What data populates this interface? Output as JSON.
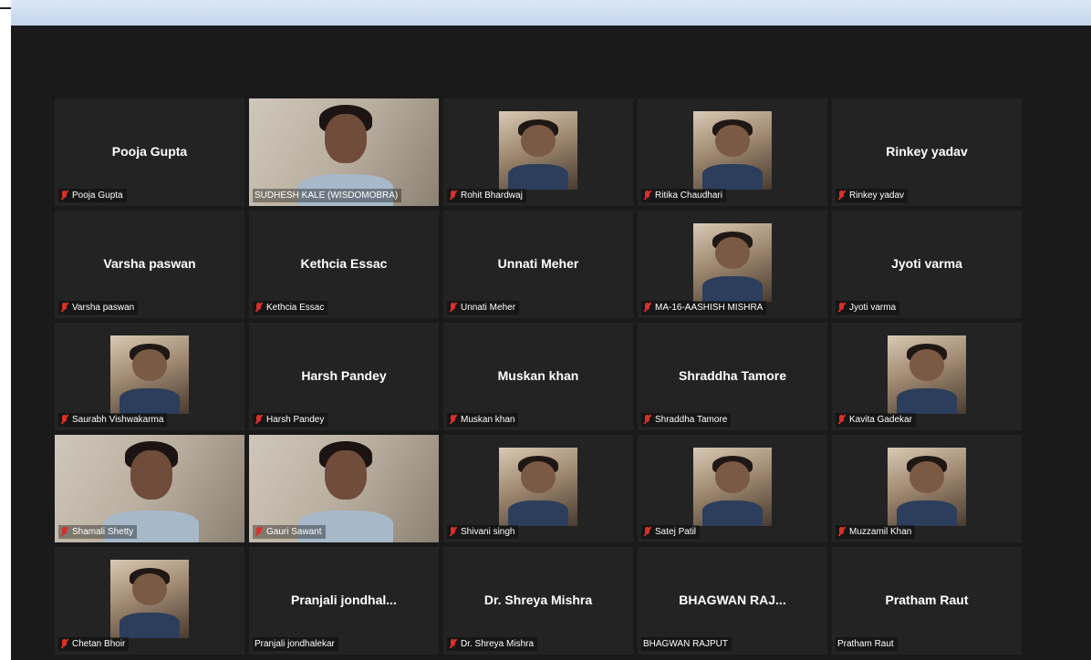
{
  "window": {
    "title": ""
  },
  "participants": [
    {
      "tile_name": "Pooja Gupta",
      "label": "Pooja Gupta",
      "video": "none",
      "muted": true
    },
    {
      "tile_name": "",
      "label": "SUDHESH KALE (WISDOMOBRA)",
      "video": "camera",
      "muted": false,
      "active_speaker": true
    },
    {
      "tile_name": "",
      "label": "Rohit Bhardwaj",
      "video": "photo",
      "muted": true
    },
    {
      "tile_name": "",
      "label": "Ritika Chaudhari",
      "video": "photo",
      "muted": true
    },
    {
      "tile_name": "Rinkey yadav",
      "label": "Rinkey yadav",
      "video": "none",
      "muted": true
    },
    {
      "tile_name": "Varsha paswan",
      "label": "Varsha paswan",
      "video": "none",
      "muted": true
    },
    {
      "tile_name": "Kethcia Essac",
      "label": "Kethcia Essac",
      "video": "none",
      "muted": true
    },
    {
      "tile_name": "Unnati Meher",
      "label": "Unnati Meher",
      "video": "none",
      "muted": true
    },
    {
      "tile_name": "",
      "label": "MA-16-AASHISH MISHRA",
      "video": "photo",
      "muted": true
    },
    {
      "tile_name": "Jyoti varma",
      "label": "Jyoti varma",
      "video": "none",
      "muted": true
    },
    {
      "tile_name": "",
      "label": "Saurabh Vishwakarma",
      "video": "photo",
      "muted": true
    },
    {
      "tile_name": "Harsh Pandey",
      "label": "Harsh Pandey",
      "video": "none",
      "muted": true
    },
    {
      "tile_name": "Muskan khan",
      "label": "Muskan khan",
      "video": "none",
      "muted": true
    },
    {
      "tile_name": "Shraddha Tamore",
      "label": "Shraddha Tamore",
      "video": "none",
      "muted": true
    },
    {
      "tile_name": "",
      "label": "Kavita Gadekar",
      "video": "photo",
      "muted": true
    },
    {
      "tile_name": "",
      "label": "Shamali Shetty",
      "video": "camera",
      "muted": true
    },
    {
      "tile_name": "",
      "label": "Gauri Sawant",
      "video": "camera",
      "muted": true
    },
    {
      "tile_name": "",
      "label": "Shivani singh",
      "video": "photo",
      "muted": true
    },
    {
      "tile_name": "",
      "label": "Satej Patil",
      "video": "photo",
      "muted": true
    },
    {
      "tile_name": "",
      "label": "Muzzamil Khan",
      "video": "photo",
      "muted": true
    },
    {
      "tile_name": "",
      "label": "Chetan Bhoir",
      "video": "photo",
      "muted": true
    },
    {
      "tile_name": "Pranjali  jondhal...",
      "label": "Pranjali jondhalekar",
      "video": "none",
      "muted": false
    },
    {
      "tile_name": "Dr. Shreya Mishra",
      "label": "Dr. Shreya Mishra",
      "video": "none",
      "muted": true
    },
    {
      "tile_name": "BHAGWAN RAJ...",
      "label": "BHAGWAN RAJPUT",
      "video": "none",
      "muted": false
    },
    {
      "tile_name": "Pratham Raut",
      "label": "Pratham Raut",
      "video": "none",
      "muted": false
    }
  ],
  "colors": {
    "background": "#1a1a1a",
    "tile": "#232323",
    "active_border": "#c4e45a",
    "muted_icon": "#d9302a"
  },
  "icons": {
    "muted": "mic-muted-icon"
  }
}
